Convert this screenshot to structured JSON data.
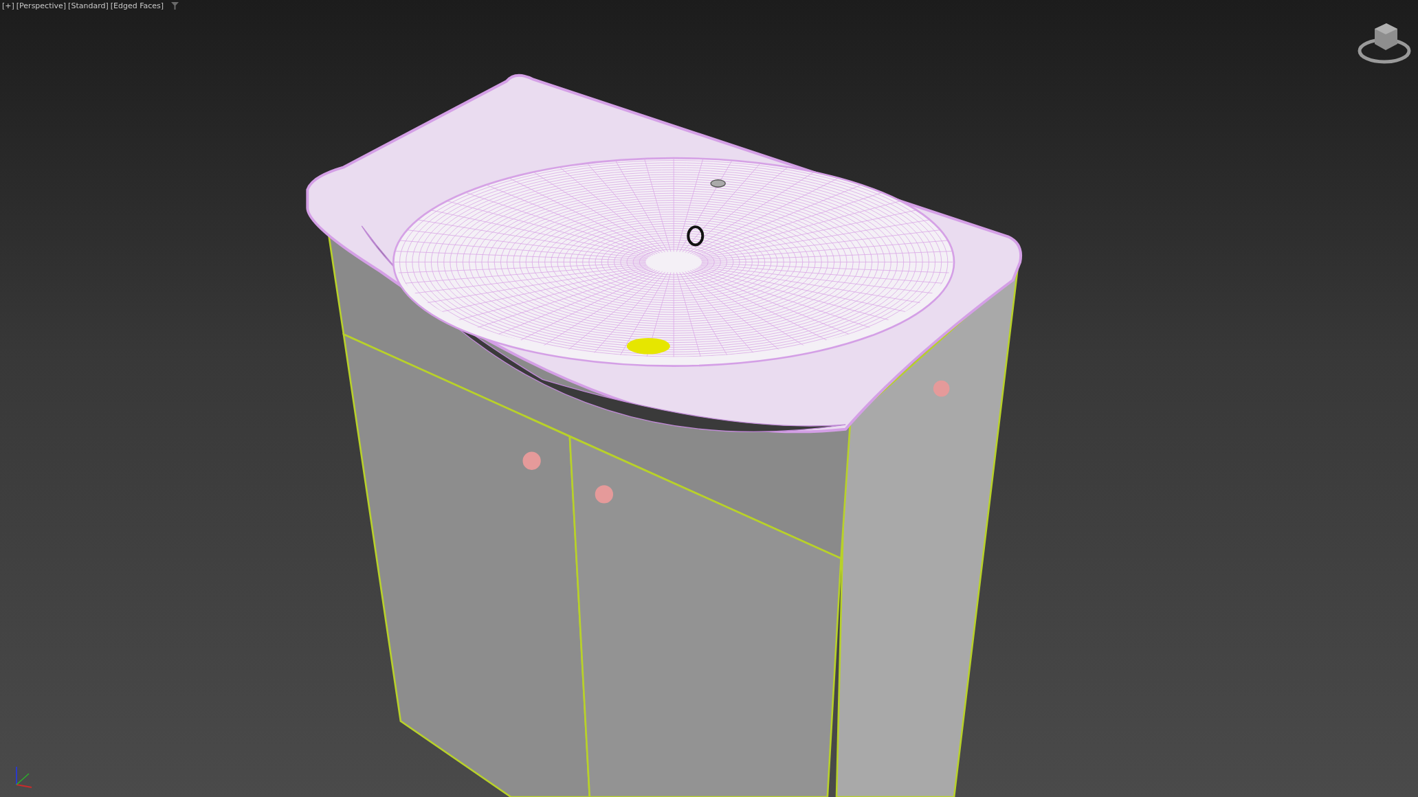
{
  "viewport": {
    "menu": [
      "[+]",
      "[Perspective]",
      "[Standard]",
      "[Edged Faces]"
    ]
  }
}
